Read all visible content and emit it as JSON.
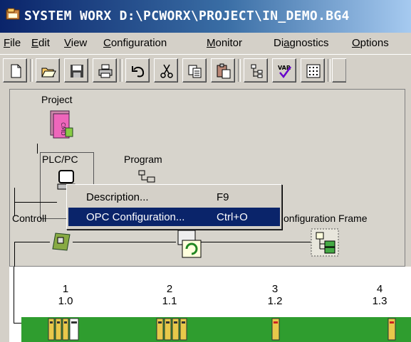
{
  "window": {
    "title": "SYSTEM WORX D:\\PCWORX\\PROJECT\\IN_DEMO.BG4"
  },
  "menu": {
    "file": {
      "u": "F",
      "rest": "ile"
    },
    "edit": {
      "u": "E",
      "rest": "dit"
    },
    "view": {
      "u": "V",
      "rest": "iew"
    },
    "configuration": {
      "u": "C",
      "rest": "onfiguration"
    },
    "monitor": {
      "u": "M",
      "rest": "onitor"
    },
    "diagnostics": {
      "pre": "Di",
      "u": "a",
      "rest": "gnostics"
    },
    "options": {
      "u": "O",
      "rest": "ptions"
    }
  },
  "toolbar": {
    "buttons": [
      "new-icon",
      "open-icon",
      "save-icon",
      "print-icon",
      "undo-icon",
      "cut-icon",
      "copy-icon",
      "paste-icon",
      "tree-icon",
      "var-check-icon",
      "io-grid-icon"
    ],
    "var_text": "VAR"
  },
  "tree": {
    "project_label": "Project",
    "project_icon_text": "CMD",
    "plcpc_label": "PLC/PC",
    "program_label": "Program",
    "controller_label": "Controll",
    "config_frame_label": "onfiguration Frame"
  },
  "context_menu": {
    "items": [
      {
        "label": "Description...",
        "shortcut": "F9",
        "selected": false
      },
      {
        "label": "OPC Configuration...",
        "shortcut": "Ctrl+O",
        "selected": true
      }
    ]
  },
  "stations": [
    {
      "num": "1",
      "addr": "1.0"
    },
    {
      "num": "2",
      "addr": "1.1"
    },
    {
      "num": "3",
      "addr": "1.2"
    },
    {
      "num": "4",
      "addr": "1.3"
    }
  ],
  "colors": {
    "titlebar_start": "#0a246a",
    "titlebar_end": "#a6caf0",
    "selection": "#0a246a",
    "bus_green": "#2f9d2f"
  }
}
